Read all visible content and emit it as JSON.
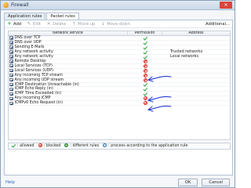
{
  "window": {
    "title": "Firewall",
    "close_label": "✕"
  },
  "tabs": [
    {
      "label": "Application rules",
      "active": false
    },
    {
      "label": "Packet rules",
      "active": true
    }
  ],
  "toolbar": {
    "add": "Add",
    "edit": "Edit",
    "delete": "Delete",
    "move_up": "Move up",
    "move_down": "Move down",
    "additional": "Additional..."
  },
  "grid": {
    "columns": [
      "Network service",
      "Permission",
      "Address"
    ],
    "rows": [
      {
        "service": "DNS over TCP",
        "permission": "allow",
        "address": ""
      },
      {
        "service": "DNS over UDP",
        "permission": "allow",
        "address": ""
      },
      {
        "service": "Sending E-Mails",
        "permission": "allow",
        "address": ""
      },
      {
        "service": "Any network activity",
        "permission": "allow",
        "address": "Trusted networks"
      },
      {
        "service": "Any network activity",
        "permission": "allow",
        "address": "Local networks"
      },
      {
        "service": "Remote Desktop",
        "permission": "block",
        "address": ""
      },
      {
        "service": "Local Services (TCP)",
        "permission": "block",
        "address": ""
      },
      {
        "service": "Local Services (UDP)",
        "permission": "block",
        "address": ""
      },
      {
        "service": "Any incoming TCP stream",
        "permission": "block",
        "address": ""
      },
      {
        "service": "Any incoming UDP stream",
        "permission": "block",
        "address": ""
      },
      {
        "service": "ICMP Destination Unreachable (in)",
        "permission": "allow",
        "address": ""
      },
      {
        "service": "ICMP Echo Reply (in)",
        "permission": "allow",
        "address": ""
      },
      {
        "service": "ICMP Time Exceeded (in)",
        "permission": "allow",
        "address": ""
      },
      {
        "service": "Any incoming ICMP",
        "permission": "block",
        "address": ""
      },
      {
        "service": "ICMPv6 Echo Request (in)",
        "permission": "block",
        "address": ""
      }
    ]
  },
  "legend": {
    "allowed": ": allowed",
    "blocked": ": blocked",
    "different": ": different rules",
    "process": ": process according to the application rule"
  },
  "footer": {
    "help": "Help",
    "ok": "OK",
    "cancel": "Cancel"
  },
  "colors": {
    "allow": "#23a139",
    "block": "#d52a20",
    "annotation": "#2a3fd0",
    "link": "#2668b8"
  }
}
